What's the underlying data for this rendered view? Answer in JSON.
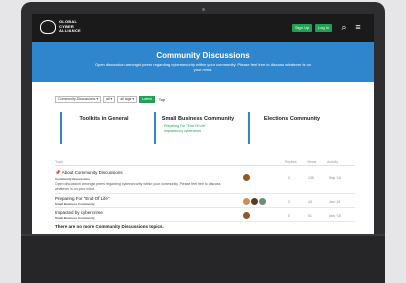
{
  "brand": {
    "logo_text": "GLOBAL\nCYBER\nALLIANCE"
  },
  "topbar": {
    "signup": "Sign Up",
    "login": "Log In",
    "search_icon": "search-icon",
    "menu_icon": "hamburger-icon"
  },
  "hero": {
    "title": "Community Discussions",
    "desc": "Open discussion amongst peers regarding cybersecurity within your community. Please feel free to discuss whatever is on your mind."
  },
  "filters": {
    "category": "Community Discussions ▾",
    "all": "all ▾",
    "tags": "all tags ▾",
    "latest": "Latest",
    "top": "Top"
  },
  "categories": [
    {
      "name": "Toolkits in General",
      "topics": []
    },
    {
      "name": "Small Business Community",
      "topics": [
        "Preparing For \"End Of Life\"",
        "Impacted by cybercrime"
      ]
    },
    {
      "name": "Elections Community",
      "topics": []
    }
  ],
  "table": {
    "topic": "Topic",
    "replies": "Replies",
    "views": "Views",
    "activity": "Activity"
  },
  "topics": [
    {
      "title": "About Community Discussions",
      "category": "Community Discussions",
      "excerpt": "Open discussion amongst peers regarding cybersecurity within your community. Please feel free to discuss whatever is on your mind.",
      "replies": "0",
      "views": "135",
      "activity": "Sep '18"
    },
    {
      "title": "Preparing For \"End Of Life\"",
      "category": "Small Business Community",
      "excerpt": "",
      "replies": "2",
      "views": "43",
      "activity": "Jan '19"
    },
    {
      "title": "Impacted by cybercrime",
      "category": "Small Business Community",
      "excerpt": "",
      "replies": "0",
      "views": "51",
      "activity": "Nov '18"
    }
  ],
  "footer_note": "There are no more Community Discussions topics.",
  "colors": {
    "accent": "#2f86cc",
    "green": "#21a155",
    "topbar": "#1a1a1a"
  }
}
